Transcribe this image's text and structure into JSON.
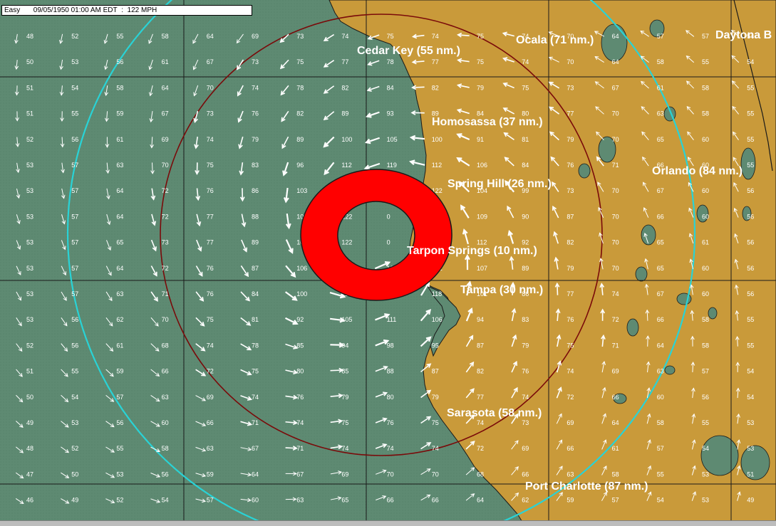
{
  "status": {
    "mode": "Easy",
    "datetime": "09/05/1950 01:00 AM EDT",
    "max_wind": "122 MPH"
  },
  "colors": {
    "water": "#5e8a72",
    "land": "#c99a3a",
    "grid": "#1a1a1a",
    "radius_ring": "#7a0a0a",
    "outer_ring": "#29d3d6",
    "eye_wall": "#ff0000",
    "arrow": "#ffffff",
    "label": "#ffffff"
  },
  "cities": [
    {
      "id": "cedar-key",
      "label": "Cedar Key (55 nm.)"
    },
    {
      "id": "ocala",
      "label": "Ocala (71 nm.)"
    },
    {
      "id": "daytona",
      "label": "Daytona B"
    },
    {
      "id": "homosassa",
      "label": "Homosassa (37 nm.)"
    },
    {
      "id": "orlando",
      "label": "Orlando (84 nm.)"
    },
    {
      "id": "spring-hill",
      "label": "Spring Hill (26 nm.)"
    },
    {
      "id": "tarpon-springs",
      "label": "Tarpon Springs (10 nm.)"
    },
    {
      "id": "tampa",
      "label": "Tampa (30 nm.)"
    },
    {
      "id": "sarasota",
      "label": "Sarasota (58 nm.)"
    },
    {
      "id": "port-charlotte",
      "label": "Port Charlotte (87 nm.)"
    }
  ],
  "wind_speeds": [
    [
      48,
      52,
      55,
      58,
      64,
      69,
      73,
      74,
      75,
      74,
      75,
      74,
      70,
      64,
      57,
      57,
      54
    ],
    [
      50,
      53,
      56,
      61,
      67,
      73,
      75,
      77,
      78,
      77,
      75,
      74,
      70,
      64,
      58,
      55,
      54
    ],
    [
      51,
      54,
      58,
      64,
      70,
      74,
      78,
      82,
      84,
      82,
      79,
      75,
      73,
      67,
      61,
      58,
      55
    ],
    [
      51,
      55,
      59,
      67,
      73,
      76,
      82,
      89,
      93,
      89,
      84,
      80,
      77,
      70,
      63,
      58,
      55
    ],
    [
      52,
      56,
      61,
      69,
      74,
      79,
      89,
      100,
      105,
      100,
      91,
      81,
      79,
      70,
      65,
      60,
      55
    ],
    [
      53,
      57,
      63,
      70,
      75,
      83,
      96,
      112,
      119,
      112,
      106,
      84,
      76,
      71,
      66,
      60,
      55
    ],
    [
      53,
      57,
      64,
      72,
      76,
      86,
      103,
      122,
      122,
      122,
      104,
      99,
      73,
      70,
      67,
      60,
      56
    ],
    [
      53,
      57,
      64,
      72,
      77,
      88,
      108,
      122,
      0,
      122,
      109,
      90,
      87,
      70,
      66,
      60,
      56
    ],
    [
      53,
      57,
      65,
      73,
      77,
      89,
      109,
      122,
      0,
      122,
      112,
      92,
      82,
      70,
      65,
      61,
      56
    ],
    [
      53,
      57,
      64,
      72,
      76,
      87,
      106,
      122,
      122,
      122,
      107,
      89,
      79,
      70,
      65,
      60,
      56
    ],
    [
      53,
      57,
      63,
      71,
      76,
      84,
      100,
      117,
      122,
      118,
      101,
      86,
      77,
      74,
      67,
      60,
      56
    ],
    [
      53,
      56,
      62,
      70,
      75,
      81,
      92,
      105,
      111,
      106,
      94,
      83,
      76,
      72,
      66,
      58,
      55
    ],
    [
      52,
      56,
      61,
      68,
      74,
      78,
      85,
      94,
      98,
      95,
      87,
      79,
      75,
      71,
      64,
      58,
      55
    ],
    [
      51,
      55,
      59,
      66,
      72,
      75,
      80,
      85,
      88,
      87,
      82,
      76,
      74,
      69,
      63,
      57,
      54
    ],
    [
      50,
      54,
      57,
      63,
      69,
      74,
      76,
      79,
      80,
      79,
      77,
      74,
      72,
      66,
      60,
      56,
      54
    ],
    [
      49,
      53,
      56,
      60,
      66,
      71,
      74,
      75,
      76,
      75,
      74,
      73,
      69,
      64,
      58,
      55,
      53
    ],
    [
      48,
      52,
      55,
      58,
      63,
      67,
      71,
      74,
      74,
      74,
      72,
      69,
      66,
      61,
      57,
      54,
      53
    ],
    [
      47,
      50,
      53,
      56,
      59,
      64,
      67,
      69,
      70,
      70,
      68,
      66,
      63,
      58,
      55,
      53,
      51
    ],
    [
      46,
      49,
      52,
      54,
      57,
      60,
      63,
      65,
      66,
      66,
      64,
      62,
      59,
      57,
      54,
      53,
      49
    ]
  ]
}
